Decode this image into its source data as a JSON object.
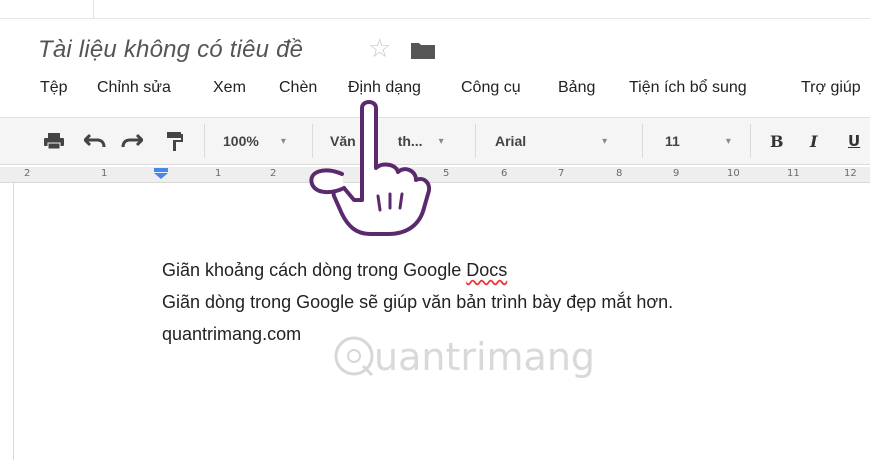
{
  "document": {
    "title": "Tài liệu không có tiêu đề"
  },
  "icons": {
    "star": "star-icon",
    "folder": "folder-icon",
    "print": "print-icon",
    "undo": "undo-icon",
    "redo": "redo-icon",
    "paint_format": "paint-format-icon",
    "hand_cursor": "hand-pointer-icon"
  },
  "menu": {
    "file": "Tệp",
    "edit": "Chỉnh sửa",
    "view": "Xem",
    "insert": "Chèn",
    "format": "Định dạng",
    "tools": "Công cụ",
    "table": "Bảng",
    "addons": "Tiện ích bổ sung",
    "help": "Trợ giúp"
  },
  "toolbar": {
    "zoom": "100%",
    "style": "Văn",
    "style_right": "th...",
    "font": "Arial",
    "size": "11",
    "bold": "B",
    "italic": "I",
    "underline": "U"
  },
  "ruler": {
    "labels": [
      "2",
      "1",
      "1",
      "2",
      "5",
      "6",
      "7",
      "8",
      "9",
      "10",
      "11",
      "12"
    ]
  },
  "body": {
    "line1_prefix": "Giãn khoảng cách dòng trong Google ",
    "line1_misspelled": "Docs",
    "line2": "Giãn dòng trong Google sẽ giúp văn bản trình bày đẹp mắt hơn.",
    "line3": "quantrimang.com"
  },
  "watermark": "uantrimang",
  "colors": {
    "title": "#555555",
    "toolbar_bg": "#f5f5f5",
    "ruler_bg": "#eeeeee",
    "cursor_outline": "#5b2a6e",
    "spell_underline": "#ee3333"
  }
}
